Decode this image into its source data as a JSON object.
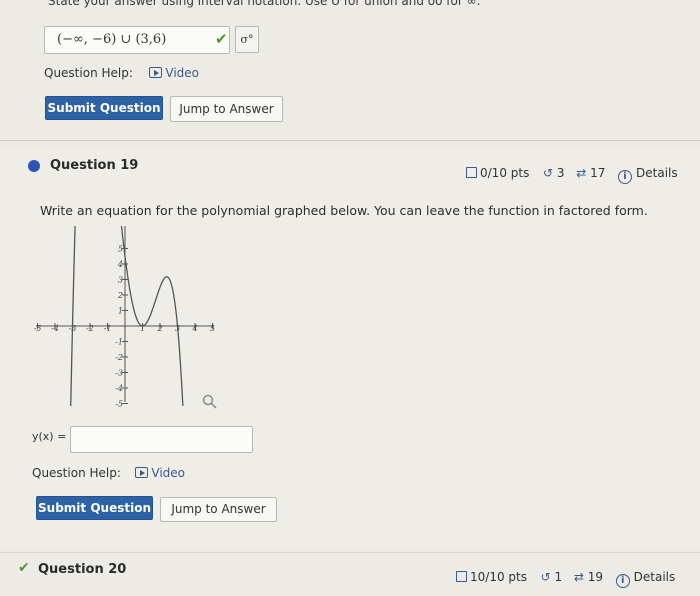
{
  "prev_question": {
    "instruction": "State your answer using interval notation. Use U for union and oo for ∞.",
    "answer_value": "(−∞, −6) ∪ (3,6)",
    "answer_status": "correct",
    "preview_symbol": "σ°",
    "help_label": "Question Help:",
    "video_label": "Video",
    "submit_label": "Submit Question",
    "jump_label": "Jump to Answer"
  },
  "question19": {
    "title": "Question 19",
    "score": "0/10 pts",
    "retries": "3",
    "attempts": "17",
    "details_label": "Details",
    "prompt": "Write an equation for the polynomial graphed below. You can leave the function in factored form.",
    "input_label": "y(x) =",
    "input_value": "",
    "help_label": "Question Help:",
    "video_label": "Video",
    "submit_label": "Submit Question",
    "jump_label": "Jump to Answer",
    "graph": {
      "x_ticks": [
        "-5",
        "-4",
        "-3",
        "-2",
        "-1",
        "1",
        "2",
        "3",
        "4",
        "5"
      ],
      "y_ticks_pos": [
        "5",
        "4",
        "3",
        "2",
        "1"
      ],
      "y_ticks_neg": [
        "-1",
        "-2",
        "-3",
        "-4",
        "-5"
      ],
      "xlim": [
        -5,
        5
      ],
      "ylim": [
        -5,
        5
      ],
      "zeros": [
        -3,
        1,
        3
      ],
      "y_intercept": 4.5
    }
  },
  "question20": {
    "title": "Question 20",
    "status": "completed",
    "score": "10/10 pts",
    "retries": "1",
    "attempts": "19",
    "details_label": "Details"
  },
  "colors": {
    "primary_button": "#2d63a6",
    "active_dot": "#2d55b8",
    "check_green": "#4c9a2a",
    "link_blue": "#3a5a88"
  }
}
